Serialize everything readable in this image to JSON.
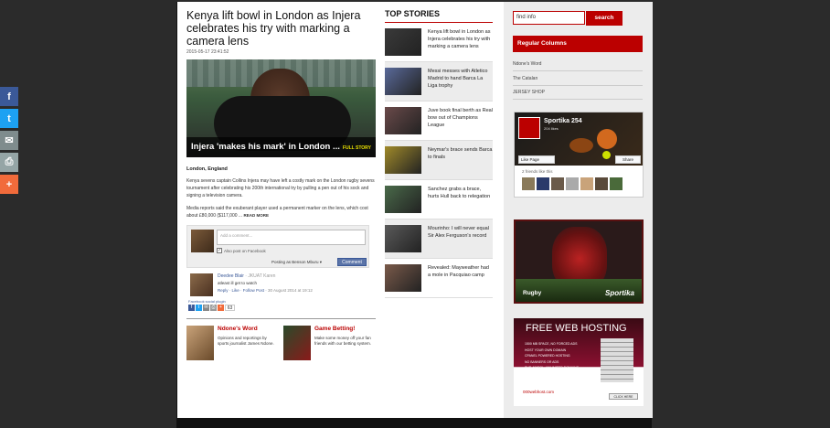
{
  "share": [
    {
      "name": "facebook",
      "glyph": "f",
      "color": "#3b5998"
    },
    {
      "name": "twitter",
      "glyph": "t",
      "color": "#1da1f2"
    },
    {
      "name": "email",
      "glyph": "✉",
      "color": "#7f8c8d"
    },
    {
      "name": "print",
      "glyph": "⎙",
      "color": "#95a5a6"
    },
    {
      "name": "more",
      "glyph": "+",
      "color": "#f16b3b"
    }
  ],
  "article": {
    "headline": "Kenya lift bowl in London as Injera celebrates his try with marking a camera lens",
    "date": "2015-05-17 23:41:52",
    "hero_caption": "Injera 'makes his mark' in London ...",
    "hero_caption_tag": "FULL STORY",
    "location": "London, England",
    "para1": "Kenya sevens captain Collins Injera may have left a costly mark on the London rugby sevens tournament after celebrating his 200th international try by pulling a pen out of his sock and signing a television camera.",
    "para2": "Media reports said the exuberant player used a permanent marker on the lens, which cost about £80,000 ($117,000 ...",
    "readmore": "READ MORE"
  },
  "comments": {
    "placeholder": "Add a comment...",
    "also_post": "Also post on Facebook",
    "posting_as": "Posting as Benson Mburu",
    "posting_caret": "▾",
    "button": "Comment",
    "item": {
      "name": "Deedee Blair",
      "affil": " · JKUAT Karen",
      "text": "atleast ill get to watch",
      "reply": "Reply",
      "like": "Like",
      "follow": "Follow Post",
      "date": "30 August 2014 at 19:12"
    },
    "plugin": "Facebook social plugin",
    "share_count": "63"
  },
  "promos": [
    {
      "title": "Ndone's Word",
      "desc": "Opinions and reportings by sports journalist James Ndone."
    },
    {
      "title": "Game Betting!",
      "desc": "Make some money off your fan friends with our betting system."
    }
  ],
  "top_stories": {
    "heading": "TOP STORIES",
    "items": [
      {
        "text": "Kenya lift bowl in London as Injera celebrates his try with marking a camera lens",
        "color": "#3a3a3a"
      },
      {
        "text": "Messi messes with Atletico Madrid to hand Barca La Liga trophy",
        "color": "#5a6a9a"
      },
      {
        "text": "Juve book final berth as Real bow out of Champions League",
        "color": "#6a4a4a"
      },
      {
        "text": "Neymar's brace sends Barca to finals",
        "color": "#a08a2a"
      },
      {
        "text": "Sanchez grabs a brace, hurts Hull back to relegation",
        "color": "#4a6a4a"
      },
      {
        "text": "Mourinho: I will never equal Sir Alex Ferguson's record",
        "color": "#5a5a5a"
      },
      {
        "text": "Revealed: Mayweather had a mole in Pacquiao camp",
        "color": "#7a5a4a"
      }
    ]
  },
  "sidebar": {
    "search_value": "find info",
    "search_button": "search",
    "regular_columns": "Regular Columns",
    "links": [
      "Ndone's Word",
      "The Catalan",
      "JERSEY SHOP"
    ],
    "fb": {
      "name": "Sportika 254",
      "likes": "204 likes",
      "like_btn": "Like Page",
      "share_btn": "Share",
      "friends": "2 friends like this"
    },
    "ad1": {
      "label": "Rugby",
      "brand": "Sportika"
    },
    "ad2": {
      "title": "FREE WEB HOSTING",
      "features": [
        "1500 MB SPACE, NO FORCED ADS",
        "HOST YOUR OWN DOMAIN",
        "CPANEL POWERED HOSTING",
        "NO BANNERS OR ADS",
        "PHP, MYSQL, UNLIMITED DOMAINS",
        "POP3 EMAIL WITH WEBMAIL ACCESS"
      ],
      "logo": "000webhost.com",
      "click": "CLICK HERE"
    }
  }
}
